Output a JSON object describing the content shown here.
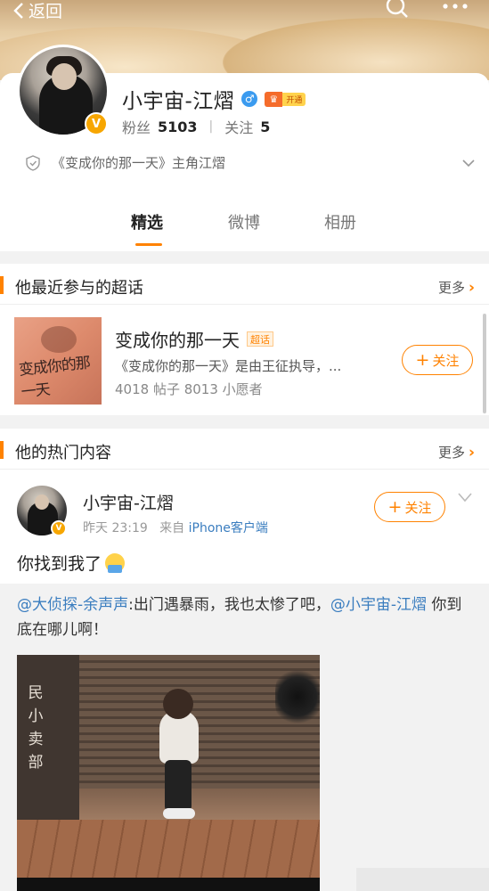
{
  "topbar": {
    "back_label": "返回"
  },
  "profile": {
    "name": "小宇宙-江熠",
    "vip_label": "开通",
    "fans_label": "粉丝",
    "fans_count": "5103",
    "following_label": "关注",
    "following_count": "5",
    "intro": "《变成你的那一天》主角江熠"
  },
  "tabs": [
    {
      "label": "精选",
      "active": true
    },
    {
      "label": "微博",
      "active": false
    },
    {
      "label": "相册",
      "active": false
    }
  ],
  "super_topic_section": {
    "title": "他最近参与的超话",
    "more_label": "更多",
    "topic": {
      "cover_text": "变成你的那一天",
      "name": "变成你的那一天",
      "tag": "超话",
      "description": "《变成你的那一天》是由王征执导，...",
      "stats": "4018 帖子 8013 小愿者",
      "follow_label": "关注"
    }
  },
  "hot_section": {
    "title": "他的热门内容",
    "more_label": "更多",
    "post": {
      "author": "小宇宙-江熠",
      "time": "昨天 23:19",
      "from_label": "来自",
      "source": "iPhone客户端",
      "follow_label": "关注",
      "text": "你找到我了",
      "repost": {
        "mention1": "@大侦探-余声声",
        "body": ":出门遇暴雨，我也太惨了吧，",
        "mention2": "@小宇宙-江熠",
        "tail": " 你到底在哪儿啊！",
        "image_sign": "民小卖部"
      }
    }
  },
  "colors": {
    "accent": "#ff8200",
    "link": "#3a7dbf",
    "verified": "#f7a600"
  }
}
